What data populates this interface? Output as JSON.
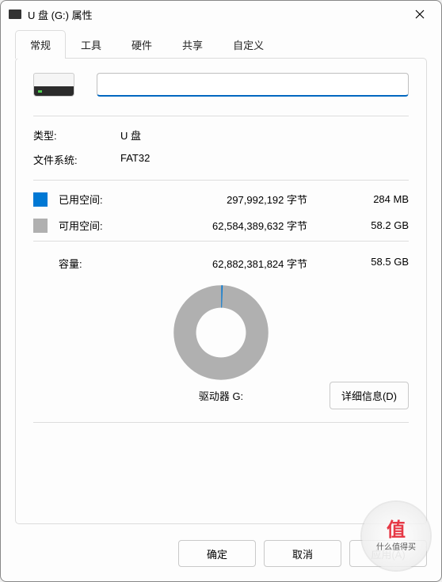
{
  "window": {
    "title": "U 盘 (G:) 属性"
  },
  "tabs": {
    "general": "常规",
    "tools": "工具",
    "hardware": "硬件",
    "sharing": "共享",
    "customize": "自定义"
  },
  "volume": {
    "name_value": "",
    "type_label": "类型:",
    "type_value": "U 盘",
    "filesystem_label": "文件系统:",
    "filesystem_value": "FAT32"
  },
  "space": {
    "used_label": "已用空间:",
    "used_bytes": "297,992,192 字节",
    "used_human": "284 MB",
    "free_label": "可用空间:",
    "free_bytes": "62,584,389,632 字节",
    "free_human": "58.2 GB",
    "capacity_label": "容量:",
    "capacity_bytes": "62,882,381,824 字节",
    "capacity_human": "58.5 GB",
    "used_color": "#0078d4",
    "free_color": "#b0b0b0"
  },
  "drive_label": "驱动器 G:",
  "buttons": {
    "details": "详细信息(D)",
    "ok": "确定",
    "cancel": "取消",
    "apply": "应用(A)"
  },
  "chart_data": {
    "type": "pie",
    "title": "",
    "series": [
      {
        "name": "已用空间",
        "value": 297992192,
        "color": "#0078d4"
      },
      {
        "name": "可用空间",
        "value": 62584389632,
        "color": "#b0b0b0"
      }
    ]
  },
  "watermark": {
    "glyph": "值",
    "text": "什么值得买"
  }
}
